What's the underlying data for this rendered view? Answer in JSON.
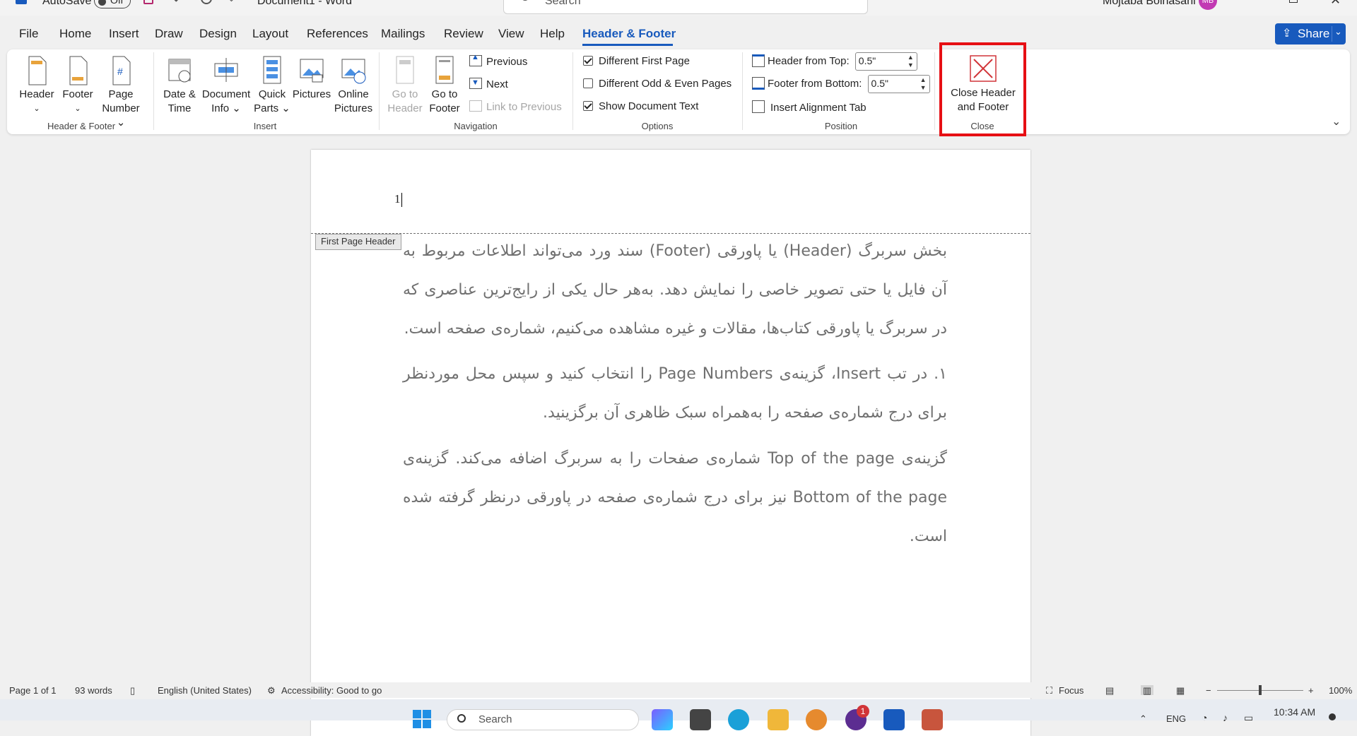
{
  "titlebar": {
    "autosave_label": "AutoSave",
    "autosave_state": "Off",
    "doc_title": "Document1 - Word",
    "search_placeholder": "Search",
    "user_name": "Mojtaba Bolhasani",
    "user_initials": "MB"
  },
  "tabs": [
    "File",
    "Home",
    "Insert",
    "Draw",
    "Design",
    "Layout",
    "References",
    "Mailings",
    "Review",
    "View",
    "Help",
    "Header & Footer"
  ],
  "active_tab": "Header & Footer",
  "share_label": "Share",
  "ribbon": {
    "groups": {
      "header_footer": {
        "label": "Header & Footer",
        "header": "Header",
        "footer": "Footer",
        "page_number_1": "Page",
        "page_number_2": "Number"
      },
      "insert": {
        "label": "Insert",
        "date_1": "Date &",
        "date_2": "Time",
        "docinfo_1": "Document",
        "docinfo_2": "Info",
        "quick_1": "Quick",
        "quick_2": "Parts",
        "pictures": "Pictures",
        "online_1": "Online",
        "online_2": "Pictures"
      },
      "navigation": {
        "label": "Navigation",
        "goto_header_1": "Go to",
        "goto_header_2": "Header",
        "goto_footer_1": "Go to",
        "goto_footer_2": "Footer",
        "previous": "Previous",
        "next": "Next",
        "link_previous": "Link to Previous"
      },
      "options": {
        "label": "Options",
        "different_first": "Different First Page",
        "different_first_checked": true,
        "odd_even": "Different Odd & Even Pages",
        "odd_even_checked": false,
        "show_doc_text": "Show Document Text",
        "show_doc_text_checked": true
      },
      "position": {
        "label": "Position",
        "header_from_top": "Header from Top:",
        "header_from_top_value": "0.5\"",
        "footer_from_bottom": "Footer from Bottom:",
        "footer_from_bottom_value": "0.5\"",
        "alignment_tab": "Insert Alignment Tab"
      },
      "close": {
        "label": "Close",
        "btn_1": "Close Header",
        "btn_2": "and Footer"
      }
    }
  },
  "document": {
    "page_number": "1",
    "header_tag": "First Page Header",
    "paragraphs": [
      "بخش سربرگ (Header) یا پاورقی (Footer) سند ورد می‌تواند اطلاعات مربوط به آن فایل یا حتی تصویر خاصی را نمایش دهد. به‌هر حال یکی از رایج‌ترین عناصری که در سربرگ یا پاورقی کتاب‌ها، مقالات و غیره مشاهده می‌کنیم، شماره‌ی صفحه است.",
      "۱. در تب Insert، گزینه‌ی Page Numbers را انتخاب کنید و سپس محل موردنظر برای درج شماره‌ی صفحه را به‌همراه سبک ظاهری آن برگزینید.",
      "گزینه‌ی Top of the page شماره‌ی صفحات را به سربرگ اضافه می‌کند. گزینه‌ی Bottom of the page نیز برای درج شماره‌ی صفحه در پاورقی درنظر گرفته شده است."
    ]
  },
  "statusbar": {
    "page": "Page 1 of 1",
    "words": "93 words",
    "language": "English (United States)",
    "accessibility": "Accessibility: Good to go",
    "focus": "Focus",
    "zoom": "100%",
    "zoom_minus": "−",
    "zoom_plus": "+"
  },
  "taskbar": {
    "search_placeholder": "Search",
    "lang": "ENG",
    "time": "10:34 AM",
    "badge": "1"
  },
  "colors": {
    "accent": "#185abd",
    "highlight": "#e60f14"
  }
}
